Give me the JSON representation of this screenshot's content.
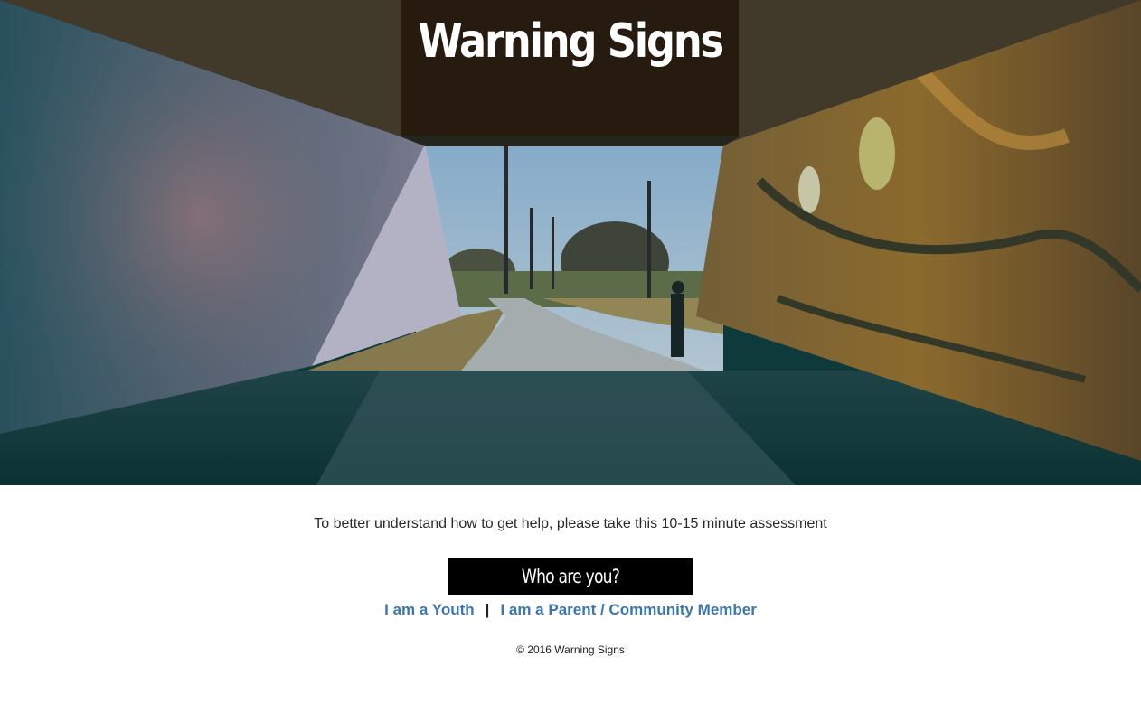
{
  "hero": {
    "title": "Warning Signs",
    "image_description_icon": "tunnel-mural-photo"
  },
  "main": {
    "intro_text": "To better understand how to get help, please take this 10-15 minute assessment",
    "who_label": "Who are you?",
    "links": [
      {
        "label": "I am a Youth"
      },
      {
        "label": "I am a Parent / Community Member"
      }
    ],
    "separator": "|"
  },
  "footer": {
    "copyright": "© 2016 Warning Signs"
  },
  "colors": {
    "link": "#3b76b0",
    "title_box": "#22140a",
    "button_bg": "#000000"
  }
}
